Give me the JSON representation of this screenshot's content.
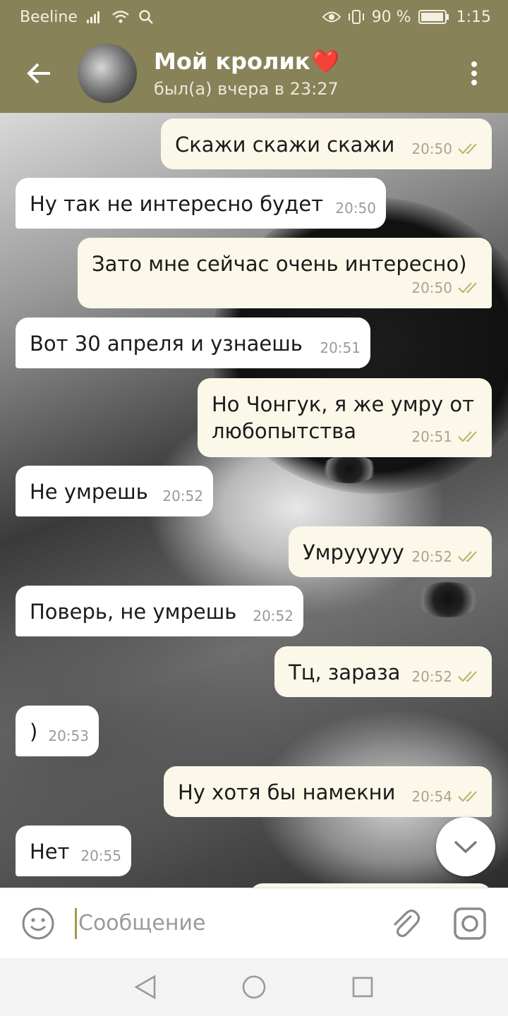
{
  "status_bar": {
    "carrier": "Beeline",
    "battery": "90 %",
    "time": "1:15"
  },
  "header": {
    "name": "Мой кролик",
    "name_emoji": "❤️",
    "status": "был(а) вчера в 23:27"
  },
  "messages": [
    {
      "dir": "out",
      "text": "Скажи скажи скажи",
      "time": "20:50",
      "read": true
    },
    {
      "dir": "in",
      "text": "Ну так не интересно будет",
      "time": "20:50"
    },
    {
      "dir": "out",
      "text": "Зато мне сейчас очень интересно)",
      "time": "20:50",
      "read": true
    },
    {
      "dir": "in",
      "text": "Вот 30 апреля и узнаешь",
      "time": "20:51"
    },
    {
      "dir": "out",
      "text_line1": "Но Чонгук, я же умру от",
      "text_line2": "любопытства",
      "time": "20:51",
      "read": true
    },
    {
      "dir": "in",
      "text": "Не умрешь",
      "time": "20:52"
    },
    {
      "dir": "out",
      "text": "Умрууууу",
      "time": "20:52",
      "read": true
    },
    {
      "dir": "in",
      "text": "Поверь, не умрешь",
      "time": "20:52"
    },
    {
      "dir": "out",
      "text": "Тц, зараза",
      "time": "20:52",
      "read": true
    },
    {
      "dir": "in",
      "text": ")",
      "time": "20:53"
    },
    {
      "dir": "out",
      "text": "Ну хотя бы намекни",
      "time": "20:54",
      "read": true
    },
    {
      "dir": "in",
      "text": "Нет",
      "time": "20:55"
    }
  ],
  "composer": {
    "placeholder": "Сообщение"
  },
  "colors": {
    "header": "#878258",
    "outgoing_bubble": "#fbf8e9",
    "incoming_bubble": "#ffffff",
    "ticks": "#9b9a56"
  }
}
